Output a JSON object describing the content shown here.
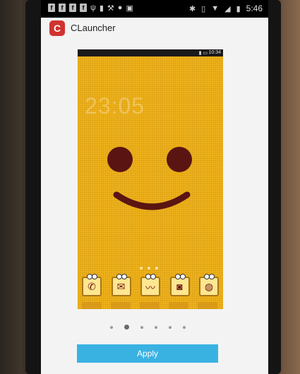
{
  "status_bar": {
    "notification_icons": [
      "facebook-icon",
      "facebook-icon",
      "facebook-icon",
      "facebook-icon",
      "usb-icon",
      "notification-icon",
      "tools-icon",
      "droid-icon",
      "shop-icon"
    ],
    "time": "5:46"
  },
  "app": {
    "title": "CLauncher",
    "logo_letter": "C"
  },
  "preview": {
    "time": "10:34",
    "clock": "23:05",
    "background_color": "#f0b21a",
    "face_color": "#5a1512",
    "dock_icons": [
      "phone-icon",
      "messages-icon",
      "mustache-icon",
      "camera-icon",
      "browser-icon"
    ]
  },
  "pager": {
    "count": 6,
    "active_index": 1
  },
  "apply_button": {
    "label": "Apply"
  }
}
